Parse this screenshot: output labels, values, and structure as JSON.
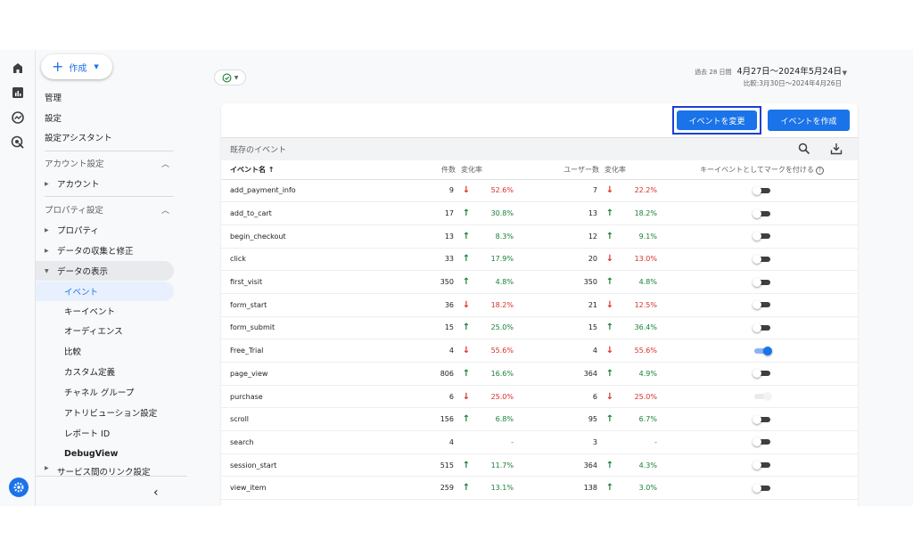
{
  "rail": {
    "items": [
      {
        "icon": "home-icon"
      },
      {
        "icon": "reports-icon"
      },
      {
        "icon": "explore-icon"
      },
      {
        "icon": "advertising-icon"
      }
    ],
    "settings_icon": "gear-icon"
  },
  "nav": {
    "create_label": "作成",
    "admin": "管理",
    "settings": "設定",
    "setup_assistant": "設定アシスタント",
    "account_section": "アカウント設定",
    "account": "アカウント",
    "property_section": "プロパティ設定",
    "property": "プロパティ",
    "data_collection": "データの収集と修正",
    "data_display": "データの表示",
    "sub_items": [
      "イベント",
      "キーイベント",
      "オーディエンス",
      "比較",
      "カスタム定義",
      "チャネル グループ",
      "アトリビューション設定",
      "レポート ID",
      "DebugView"
    ],
    "service_links": "サービス間のリンク設定"
  },
  "header": {
    "date_prefix": "過去 28 日間",
    "date_range": "4月27日～2024年5月24日",
    "compare_range": "比較:3月30日～2024年4月26日"
  },
  "toolbar": {
    "modify_event": "イベントを変更",
    "create_event": "イベントを作成",
    "existing_events": "既存のイベント"
  },
  "table": {
    "headers": {
      "event_name": "イベント名 ↑",
      "count": "件数",
      "change": "変化率",
      "users": "ユーザー数",
      "users_change": "変化率",
      "key_event": "キーイベントとしてマークを付ける"
    },
    "rows": [
      {
        "name": "add_payment_info",
        "count": "9",
        "dir": "down",
        "rate": "52.6%",
        "users": "7",
        "udir": "down",
        "urate": "22.2%",
        "key": "off"
      },
      {
        "name": "add_to_cart",
        "count": "17",
        "dir": "up",
        "rate": "30.8%",
        "users": "13",
        "udir": "up",
        "urate": "18.2%",
        "key": "off"
      },
      {
        "name": "begin_checkout",
        "count": "13",
        "dir": "up",
        "rate": "8.3%",
        "users": "12",
        "udir": "up",
        "urate": "9.1%",
        "key": "off"
      },
      {
        "name": "click",
        "count": "33",
        "dir": "up",
        "rate": "17.9%",
        "users": "20",
        "udir": "down",
        "urate": "13.0%",
        "key": "off"
      },
      {
        "name": "first_visit",
        "count": "350",
        "dir": "up",
        "rate": "4.8%",
        "users": "350",
        "udir": "up",
        "urate": "4.8%",
        "key": "off"
      },
      {
        "name": "form_start",
        "count": "36",
        "dir": "down",
        "rate": "18.2%",
        "users": "21",
        "udir": "down",
        "urate": "12.5%",
        "key": "off"
      },
      {
        "name": "form_submit",
        "count": "15",
        "dir": "up",
        "rate": "25.0%",
        "users": "15",
        "udir": "up",
        "urate": "36.4%",
        "key": "off"
      },
      {
        "name": "Free_Trial",
        "count": "4",
        "dir": "down",
        "rate": "55.6%",
        "users": "4",
        "udir": "down",
        "urate": "55.6%",
        "key": "on"
      },
      {
        "name": "page_view",
        "count": "806",
        "dir": "up",
        "rate": "16.6%",
        "users": "364",
        "udir": "up",
        "urate": "4.9%",
        "key": "off"
      },
      {
        "name": "purchase",
        "count": "6",
        "dir": "down",
        "rate": "25.0%",
        "users": "6",
        "udir": "down",
        "urate": "25.0%",
        "key": "disabled"
      },
      {
        "name": "scroll",
        "count": "156",
        "dir": "up",
        "rate": "6.8%",
        "users": "95",
        "udir": "up",
        "urate": "6.7%",
        "key": "off"
      },
      {
        "name": "search",
        "count": "4",
        "dir": "none",
        "rate": "-",
        "users": "3",
        "udir": "none",
        "urate": "-",
        "key": "off"
      },
      {
        "name": "session_start",
        "count": "515",
        "dir": "up",
        "rate": "11.7%",
        "users": "364",
        "udir": "up",
        "urate": "4.3%",
        "key": "off"
      },
      {
        "name": "view_item",
        "count": "259",
        "dir": "up",
        "rate": "13.1%",
        "users": "138",
        "udir": "up",
        "urate": "3.0%",
        "key": "off"
      }
    ]
  },
  "colors": {
    "accent": "#1a73e8",
    "up": "#188038",
    "down": "#d93025"
  }
}
